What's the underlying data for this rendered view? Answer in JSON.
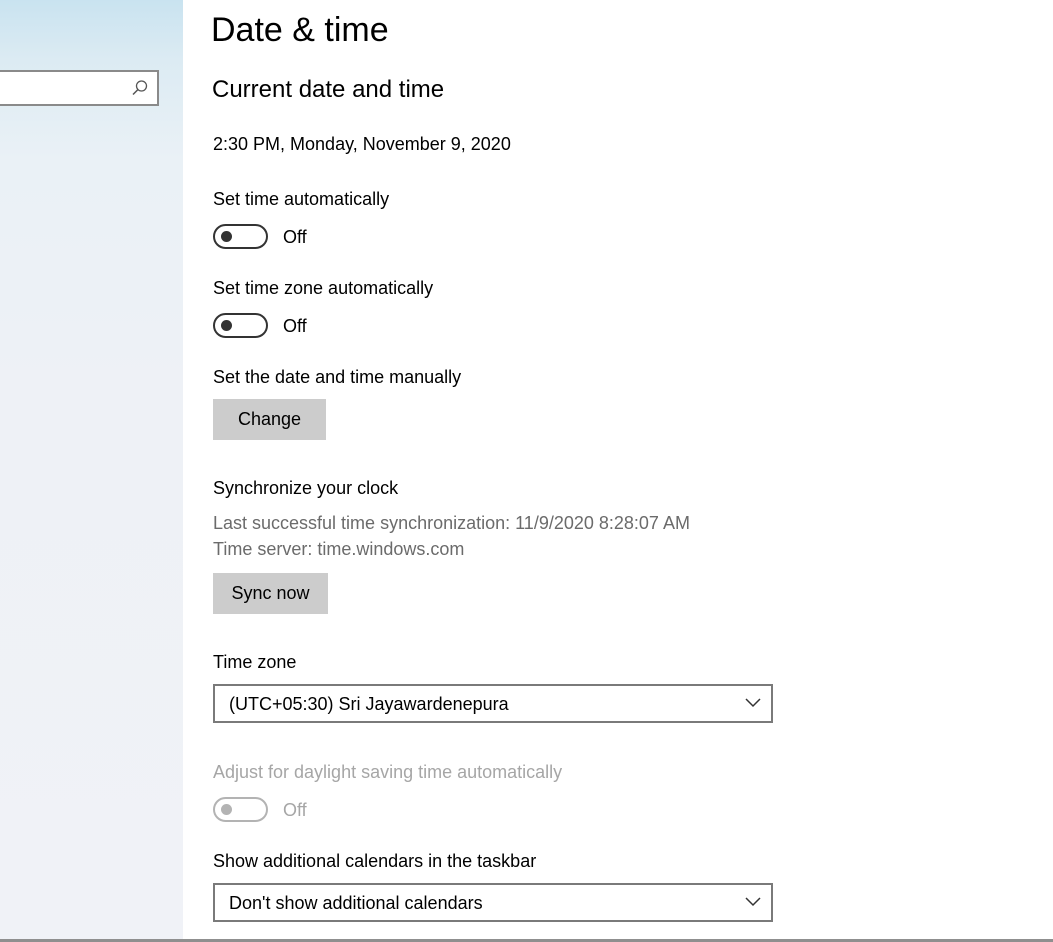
{
  "window": {
    "title": "Date & time"
  },
  "sidebar": {
    "search": {
      "placeholder": "",
      "icon": "search-icon"
    }
  },
  "main": {
    "section_title": "Current date and time",
    "current_datetime": "2:30 PM, Monday, November 9, 2020",
    "set_time_auto": {
      "label": "Set time automatically",
      "state": "Off"
    },
    "set_timezone_auto": {
      "label": "Set time zone automatically",
      "state": "Off"
    },
    "manual": {
      "label": "Set the date and time manually",
      "button": "Change"
    },
    "sync": {
      "label": "Synchronize your clock",
      "last_sync": "Last successful time synchronization: 11/9/2020 8:28:07 AM",
      "server": "Time server: time.windows.com",
      "button": "Sync now"
    },
    "timezone": {
      "label": "Time zone",
      "value": "(UTC+05:30) Sri Jayawardenepura"
    },
    "dst": {
      "label": "Adjust for daylight saving time automatically",
      "state": "Off"
    },
    "calendars": {
      "label": "Show additional calendars in the taskbar",
      "value": "Don't show additional calendars"
    }
  },
  "colors": {
    "button_bg": "#cccccc",
    "toggle_off": "#333333",
    "disabled": "#a6a6a6",
    "muted_text": "#6b6b6b"
  }
}
